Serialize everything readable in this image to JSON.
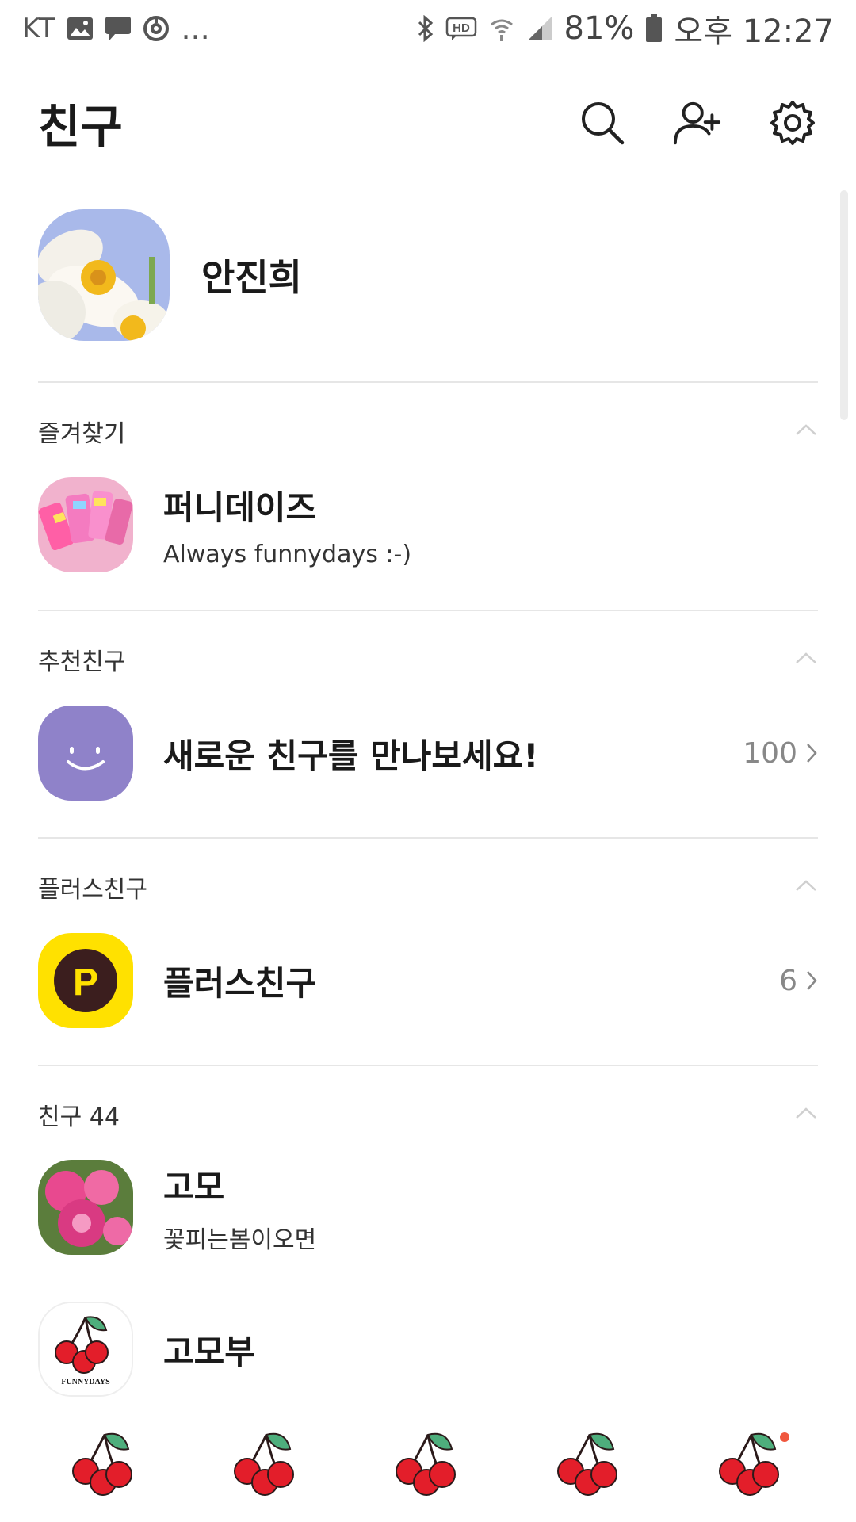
{
  "status_bar": {
    "carrier": "KT",
    "more": "...",
    "hd_label": "HD",
    "battery_percent": "81%",
    "time": "오후 12:27"
  },
  "header": {
    "title": "친구",
    "icons": [
      "search-icon",
      "add-friend-icon",
      "settings-icon"
    ]
  },
  "profile": {
    "name": "안진희"
  },
  "sections": {
    "favorites": {
      "label": "즐겨찾기",
      "items": [
        {
          "name": "퍼니데이즈",
          "status": "Always funnydays :-)"
        }
      ]
    },
    "recommended": {
      "label": "추천친구",
      "item": {
        "title": "새로운 친구를 만나보세요!",
        "count": "100"
      }
    },
    "plus_friends": {
      "label": "플러스친구",
      "item": {
        "title": "플러스친구",
        "count": "6"
      },
      "logo_letter": "P"
    },
    "friends": {
      "label": "친구 44",
      "items": [
        {
          "name": "고모",
          "status": "꽃피는봄이오면"
        },
        {
          "name": "고모부",
          "status": "",
          "logo_text": "FUNNYDAYS"
        }
      ]
    }
  },
  "tabbar": {
    "tabs": [
      "friends-tab",
      "chats-tab",
      "search-tab",
      "news-tab",
      "more-tab"
    ],
    "badge_color": "#f0573e"
  },
  "colors": {
    "purple": "#8f82c9",
    "yellow": "#ffe100",
    "divider": "#e6e6e6"
  }
}
